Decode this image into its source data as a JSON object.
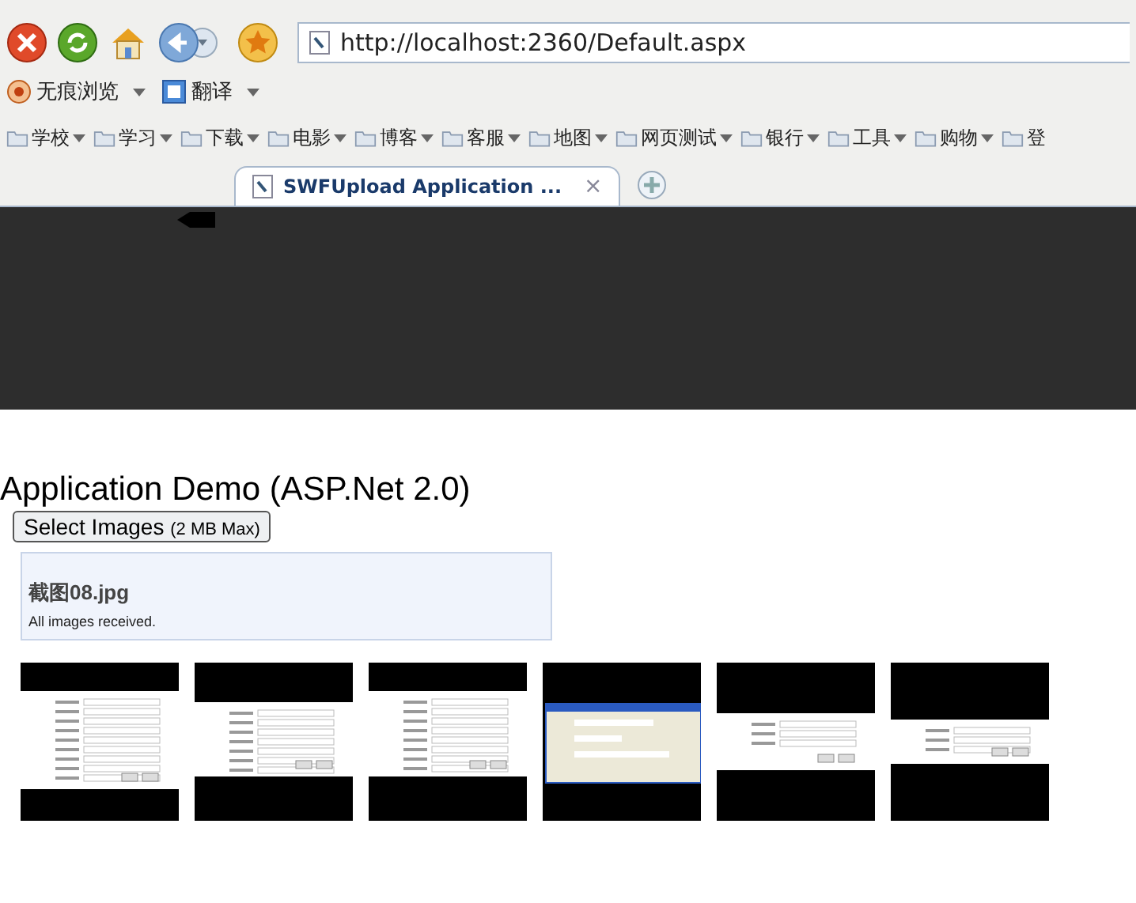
{
  "browser": {
    "address": "http://localhost:2360/Default.aspx",
    "menu_items": [
      {
        "label": "无痕浏览"
      },
      {
        "label": "翻译"
      }
    ],
    "bookmarks": [
      {
        "label": "学校",
        "menu": true
      },
      {
        "label": "学习",
        "menu": true
      },
      {
        "label": "下载",
        "menu": true
      },
      {
        "label": "电影",
        "menu": true
      },
      {
        "label": "博客",
        "menu": true
      },
      {
        "label": "客服",
        "menu": true
      },
      {
        "label": "地图",
        "menu": true
      },
      {
        "label": "网页测试",
        "menu": true
      },
      {
        "label": "银行",
        "menu": true
      },
      {
        "label": "工具",
        "menu": true
      },
      {
        "label": "购物",
        "menu": true
      },
      {
        "label": "登",
        "menu": false
      }
    ],
    "tabs": [
      {
        "label": "SWFUpload Application ...",
        "selected": true,
        "close": "×"
      }
    ]
  },
  "page": {
    "title": "Application Demo (ASP.Net 2.0)",
    "button": {
      "label": "Select Images",
      "note": "(2 MB Max)"
    },
    "status": {
      "file": "截图08.jpg",
      "message": "All images received."
    }
  }
}
